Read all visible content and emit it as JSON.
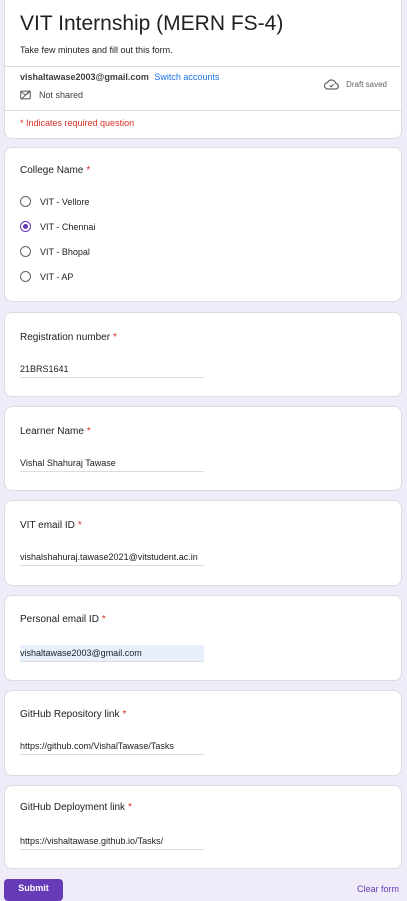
{
  "form": {
    "title": "VIT Internship (MERN FS-4)",
    "description": "Take few minutes and fill out this form.",
    "account_email": "vishaltawase2003@gmail.com",
    "switch_accounts": "Switch accounts",
    "not_shared": "Not shared",
    "draft_status": "Draft saved",
    "required_note": "* Indicates required question"
  },
  "college": {
    "title": "College Name",
    "required": "*",
    "options": [
      {
        "label": "VIT - Vellore",
        "selected": false
      },
      {
        "label": "VIT - Chennai",
        "selected": true
      },
      {
        "label": "VIT - Bhopal",
        "selected": false
      },
      {
        "label": "VIT - AP",
        "selected": false
      }
    ]
  },
  "questions": [
    {
      "title": "Registration number",
      "required": "*",
      "value": "21BRS1641"
    },
    {
      "title": "Learner Name",
      "required": "*",
      "value": "Vishal Shahuraj Tawase"
    },
    {
      "title": "VIT email ID",
      "required": "*",
      "value": "vishalshahuraj.tawase2021@vitstudent.ac.in"
    },
    {
      "title": "Personal email ID",
      "required": "*",
      "value": "vishaltawase2003@gmail.com"
    },
    {
      "title": "GitHub Repository link",
      "required": "*",
      "value": "https://github.com/VishalTawase/Tasks"
    },
    {
      "title": "GitHub Deployment link",
      "required": "*",
      "value": "https://vishaltawase.github.io/Tasks/"
    }
  ],
  "actions": {
    "submit": "Submit",
    "clear": "Clear form"
  },
  "colors": {
    "accent": "#673ab7",
    "background": "#f0ebf8",
    "required": "#d93025",
    "link": "#1a73e8"
  }
}
